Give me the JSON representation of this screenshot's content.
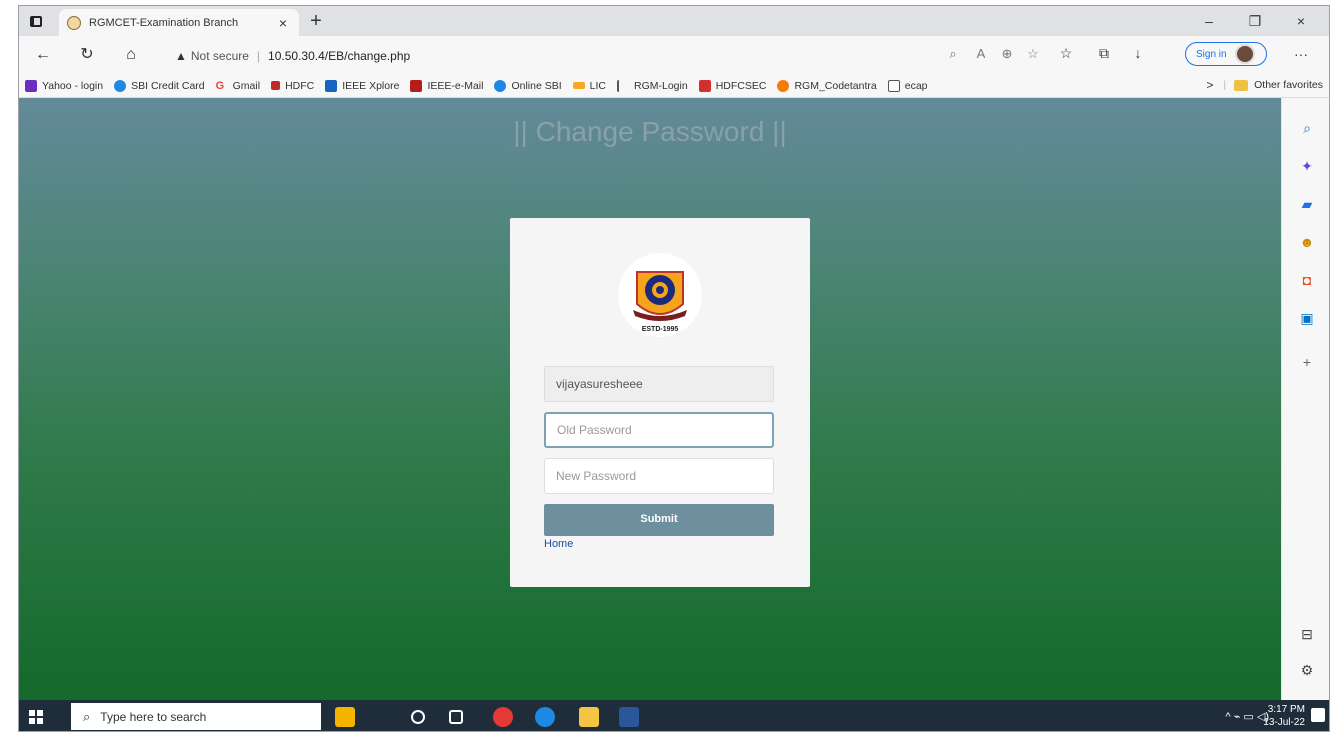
{
  "browser": {
    "tab_title": "RGMCET-Examination Branch",
    "tab_close": "×",
    "new_tab": "+",
    "minimize": "–",
    "restore": "❐",
    "close": "×",
    "security_label": "Not secure",
    "url": "10.50.30.4/EB/change.php",
    "sign_in_label": "Sign in",
    "more_label": "···"
  },
  "favorites": [
    {
      "label": "Yahoo - login",
      "color": "#6a2fc0"
    },
    {
      "label": "SBI Credit Card",
      "color": "#1e88e5"
    },
    {
      "label": "Gmail",
      "color": "#ea4335"
    },
    {
      "label": "HDFC",
      "color": "#c62828"
    },
    {
      "label": "IEEE Xplore",
      "color": "#1565c0"
    },
    {
      "label": "IEEE-e-Mail",
      "color": "#b71c1c"
    },
    {
      "label": "Online SBI",
      "color": "#1e88e5"
    },
    {
      "label": "LIC",
      "color": "#f9a825"
    },
    {
      "label": "RGM-Login",
      "color": "#555555"
    },
    {
      "label": "HDFCSEC",
      "color": "#d32f2f"
    },
    {
      "label": "RGM_Codetantra",
      "color": "#f57c00"
    },
    {
      "label": "ecap",
      "color": "#ffffff"
    }
  ],
  "favorites_more": ">",
  "favorites_other": "Other favorites",
  "page": {
    "heading": "|| Change Password ||",
    "logo_text": "ESTD-1995",
    "username_value": "vijayasuresheee",
    "old_password_placeholder": "Old Password",
    "new_password_placeholder": "New Password",
    "submit_label": "Submit",
    "home_link": "Home"
  },
  "taskbar": {
    "search_placeholder": "Type here to search",
    "time": "3:17 PM",
    "date": "13-Jul-22",
    "tray_icons": "^ ⌁ ▭ ◁)"
  }
}
